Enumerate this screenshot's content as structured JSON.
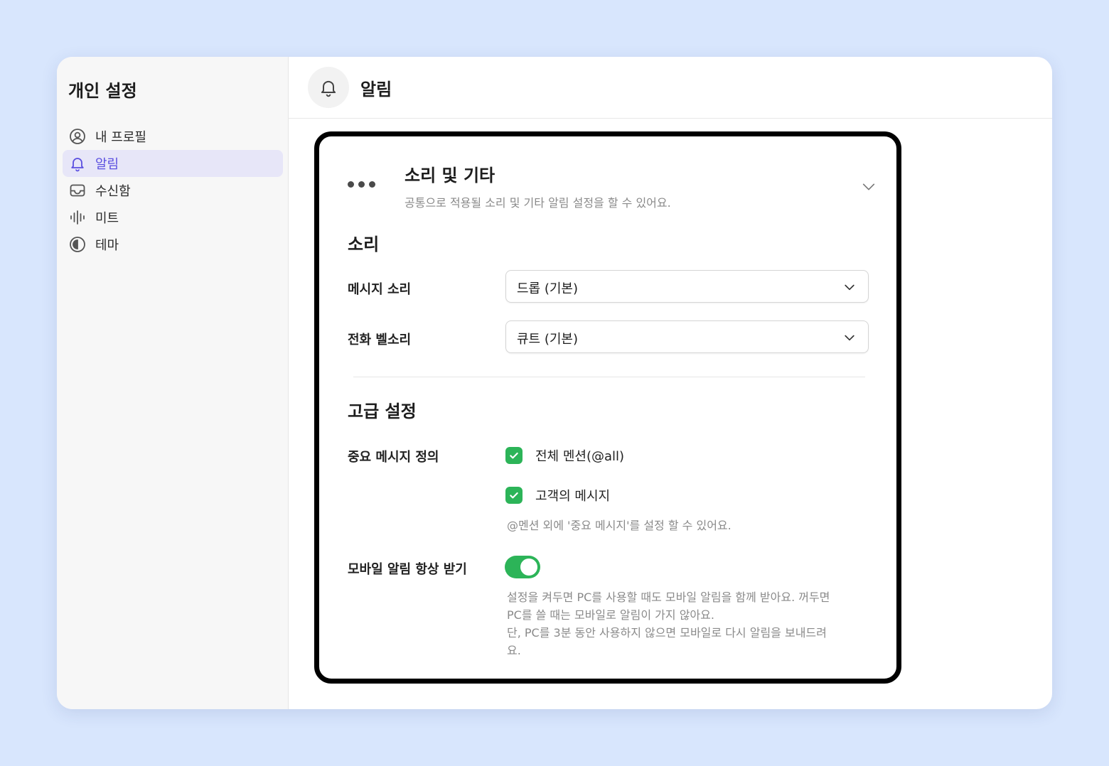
{
  "sidebar": {
    "title": "개인 설정",
    "items": [
      {
        "label": "내 프로필",
        "icon": "user-circle-icon",
        "active": false
      },
      {
        "label": "알림",
        "icon": "bell-icon",
        "active": true
      },
      {
        "label": "수신함",
        "icon": "inbox-icon",
        "active": false
      },
      {
        "label": "미트",
        "icon": "audio-wave-icon",
        "active": false
      },
      {
        "label": "테마",
        "icon": "contrast-icon",
        "active": false
      }
    ]
  },
  "header": {
    "title": "알림",
    "icon": "bell-icon"
  },
  "card": {
    "title": "소리 및 기타",
    "subtitle": "공통으로 적용될 소리 및 기타 알림 설정을 할 수 있어요.",
    "sound": {
      "section_title": "소리",
      "message_sound_label": "메시지 소리",
      "message_sound_value": "드롭 (기본)",
      "ringtone_label": "전화 벨소리",
      "ringtone_value": "큐트 (기본)"
    },
    "advanced": {
      "section_title": "고급 설정",
      "important_label": "중요 메시지 정의",
      "options": [
        {
          "label": "전체 멘션(@all)",
          "checked": true
        },
        {
          "label": "고객의 메시지",
          "checked": true
        }
      ],
      "important_hint": "@멘션 외에 '중요 메시지'를 설정 할 수 있어요.",
      "mobile_label": "모바일 알림 항상 받기",
      "mobile_enabled": true,
      "mobile_hint_lines": [
        "설정을 켜두면 PC를 사용할 때도 모바일 알림을 함께 받아요. 꺼두면",
        "PC를 쓸 때는 모바일로 알림이 가지 않아요.",
        "단, PC를 3분 동안 사용하지 않으면 모바일로 다시 알림을 보내드려",
        "요."
      ]
    }
  },
  "colors": {
    "background": "#d8e6fd",
    "accent": "#5b4fe0",
    "active_nav_bg": "#e7e6f8",
    "success_green": "#2cb458"
  }
}
